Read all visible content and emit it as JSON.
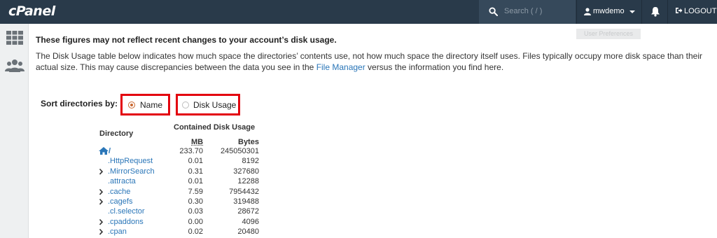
{
  "header": {
    "logo": "cPanel",
    "search_placeholder": "Search ( / )",
    "username": "mwdemo",
    "logout_label": "LOGOUT",
    "tooltip": "User Preferences",
    "bg_color": "#293a4a"
  },
  "sidebar": {
    "items": [
      {
        "icon": "grid-icon"
      },
      {
        "icon": "users-icon"
      }
    ]
  },
  "notice": {
    "warning": "These figures may not reflect recent changes to your account’s disk usage.",
    "desc_before": "The Disk Usage table below indicates how much space the directories’ contents use, not how much space the directory itself uses. Files typically occupy more disk space than their actual size. This may cause discrepancies between the data you see in the ",
    "link": "File Manager",
    "desc_after": " versus the information you find here."
  },
  "sort": {
    "label": "Sort directories by:",
    "options": [
      {
        "label": "Name",
        "selected": true
      },
      {
        "label": "Disk Usage",
        "selected": false
      }
    ],
    "highlight_color": "#e3000e"
  },
  "table": {
    "col_directory": "Directory",
    "col_group": "Contained Disk Usage",
    "col_mb": "MB",
    "col_bytes": "Bytes",
    "rows": [
      {
        "name": "/",
        "home": true,
        "expandable": false,
        "mb": "233.70",
        "bytes": "245050301"
      },
      {
        "name": ".HttpRequest",
        "expandable": false,
        "mb": "0.01",
        "bytes": "8192"
      },
      {
        "name": ".MirrorSearch",
        "expandable": true,
        "mb": "0.31",
        "bytes": "327680"
      },
      {
        "name": ".attracta",
        "expandable": false,
        "mb": "0.01",
        "bytes": "12288"
      },
      {
        "name": ".cache",
        "expandable": true,
        "mb": "7.59",
        "bytes": "7954432"
      },
      {
        "name": ".cagefs",
        "expandable": true,
        "mb": "0.30",
        "bytes": "319488"
      },
      {
        "name": ".cl.selector",
        "expandable": false,
        "mb": "0.03",
        "bytes": "28672"
      },
      {
        "name": ".cpaddons",
        "expandable": true,
        "mb": "0.00",
        "bytes": "4096"
      },
      {
        "name": ".cpan",
        "expandable": true,
        "mb": "0.02",
        "bytes": "20480"
      }
    ]
  }
}
